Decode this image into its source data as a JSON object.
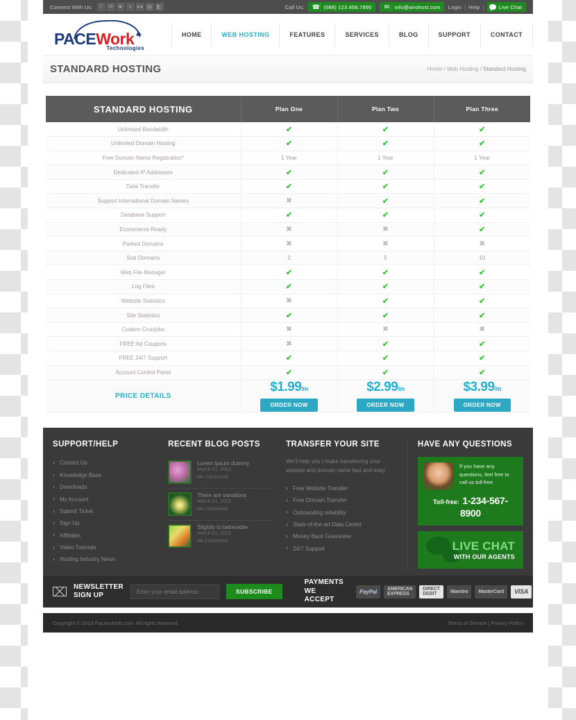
{
  "topbar": {
    "connect_label": "Connect With Us:",
    "social_icons": [
      {
        "name": "facebook-icon",
        "glyph": "f"
      },
      {
        "name": "twitter-icon",
        "glyph": "✉"
      },
      {
        "name": "flickr-icon",
        "glyph": "■"
      },
      {
        "name": "vimeo-icon",
        "glyph": "v"
      },
      {
        "name": "dribbble-icon",
        "glyph": "●●"
      },
      {
        "name": "rss-icon",
        "glyph": "▤"
      },
      {
        "name": "feed-icon",
        "glyph": "◧"
      }
    ],
    "call_us_label": "Call Us:",
    "phone_icon": "☎",
    "phone": "(088) 123.456.7890",
    "email_icon": "✉",
    "email": "info@airohost.com",
    "login": "Login",
    "help": "Help",
    "separator": "|",
    "live_chat": "Live Chat"
  },
  "logo": {
    "part1": "PACE",
    "part2": "Work",
    "tagline": "Technologies",
    "color_primary": "#1b3a7a",
    "color_accent": "#d52026"
  },
  "nav": {
    "items": [
      {
        "label": "HOME",
        "active": false
      },
      {
        "label": "WEB HOSTING",
        "active": true
      },
      {
        "label": "FEATURES",
        "active": false
      },
      {
        "label": "SERVICES",
        "active": false
      },
      {
        "label": "BLOG",
        "active": false
      },
      {
        "label": "SUPPORT",
        "active": false
      },
      {
        "label": "CONTACT",
        "active": false
      }
    ],
    "active_color": "#22b0cc"
  },
  "page": {
    "title": "STANDARD HOSTING",
    "breadcrumb": {
      "home": "Home",
      "sep1": "/",
      "section": "Web Hosting",
      "sep2": "/",
      "current": "Standard Hosting"
    }
  },
  "pricing_table": {
    "feature_header": "STANDARD HOSTING",
    "plans": [
      "Plan One",
      "Plan Two",
      "Plan Three"
    ],
    "rows": [
      {
        "feature": "Unlimited Bandwidth",
        "values": [
          "tick",
          "tick",
          "tick"
        ]
      },
      {
        "feature": "Unlimited Domain Hosting",
        "values": [
          "tick",
          "tick",
          "tick"
        ]
      },
      {
        "feature": "Free Domain Name Registration*",
        "values": [
          "1 Year",
          "1 Year",
          "1 Year"
        ]
      },
      {
        "feature": "Dedicated IP Addresses",
        "values": [
          "tick",
          "tick",
          "tick"
        ]
      },
      {
        "feature": "Data Transfer",
        "values": [
          "tick",
          "tick",
          "tick"
        ]
      },
      {
        "feature": "Support International Domain Names",
        "values": [
          "cross",
          "tick",
          "tick"
        ]
      },
      {
        "feature": "Database Support",
        "values": [
          "tick",
          "tick",
          "tick"
        ]
      },
      {
        "feature": "Ecommerce Ready",
        "values": [
          "cross",
          "cross",
          "tick"
        ]
      },
      {
        "feature": "Parked Domains",
        "values": [
          "cross",
          "cross",
          "cross"
        ]
      },
      {
        "feature": "Sub Domains",
        "values": [
          "2",
          "5",
          "10"
        ]
      },
      {
        "feature": "Web File Manager",
        "values": [
          "tick",
          "tick",
          "tick"
        ]
      },
      {
        "feature": "Log Files",
        "values": [
          "tick",
          "tick",
          "tick"
        ]
      },
      {
        "feature": "Website Statistics",
        "values": [
          "cross",
          "tick",
          "tick"
        ]
      },
      {
        "feature": "Site Statistics",
        "values": [
          "tick",
          "tick",
          "tick"
        ]
      },
      {
        "feature": "Custom Cronjobs",
        "values": [
          "cross",
          "cross",
          "cross"
        ]
      },
      {
        "feature": "FREE Ad Coupons",
        "values": [
          "cross",
          "tick",
          "tick"
        ]
      },
      {
        "feature": "FREE 24/7 Support",
        "values": [
          "tick",
          "tick",
          "tick"
        ]
      },
      {
        "feature": "Account Control Panel",
        "values": [
          "tick",
          "tick",
          "tick"
        ]
      }
    ],
    "price_row": {
      "label": "PRICE DETAILS",
      "prices": [
        {
          "amount": "$1.99",
          "period": "/m",
          "button": "ORDER NOW"
        },
        {
          "amount": "$2.99",
          "period": "/m",
          "button": "ORDER NOW"
        },
        {
          "amount": "$3.99",
          "period": "/m",
          "button": "ORDER NOW"
        }
      ]
    },
    "tick_color": "#3bc13b",
    "cross_color": "#bdbdbd",
    "accent_color": "#22b0cc"
  },
  "footer": {
    "support": {
      "title": "SUPPORT/HELP",
      "links": [
        "Contact Us",
        "Knowledge Base",
        "Downloads",
        "My Account",
        "Submit Ticket",
        "Sign Up",
        "Affiliates",
        "Video Tutorials",
        "Hosting Industry News"
      ]
    },
    "blog": {
      "title": "RECENT BLOG POSTS",
      "posts": [
        {
          "title": "Lorem Ipsum dummy",
          "date": "March 01, 2013",
          "comments": "No Comments"
        },
        {
          "title": "There are variations",
          "date": "March 01, 2013",
          "comments": "No Comments"
        },
        {
          "title": "Slightly to believable",
          "date": "March 01, 2013",
          "comments": "No Comments"
        }
      ]
    },
    "transfer": {
      "title": "TRANSFER YOUR SITE",
      "description": "We'll help you t make transferring your website and domain name fast and easy",
      "links": [
        "Free Website Transfer",
        "Free Domain Transfer",
        "Outstanding reliability",
        "State-of-the-art Data Center",
        "Money Back Guarantee",
        "24/7 Support"
      ]
    },
    "questions": {
      "title": "HAVE ANY QUESTIONS",
      "call_text": "If you have any questions, feel free to call us toll-free",
      "tollfree_label": "Toll-free:",
      "tollfree_number": "1-234-567-8900",
      "livechat_title": "LIVE CHAT",
      "livechat_sub": "WITH OUR AGENTS",
      "green": "#1d7a1d"
    }
  },
  "newsletter": {
    "line1": "NEWSLETTER",
    "line2": "SIGN UP",
    "placeholder": "Enter your email address",
    "value": "",
    "subscribe": "SUBSCRIBE"
  },
  "payments": {
    "line1": "PAYMENTS",
    "line2": "WE ACCEPT",
    "logos": [
      "PayPal",
      "AMERICAN EXPRESS",
      "DIRECT DEBIT",
      "Maestro",
      "MasterCard",
      "VISA"
    ]
  },
  "copyright": {
    "text": "Copyright © 2013 Pacesubmit.com. All rights reserved.",
    "terms": "Terms of Service",
    "sep": "|",
    "privacy": "Privacy Policy"
  }
}
